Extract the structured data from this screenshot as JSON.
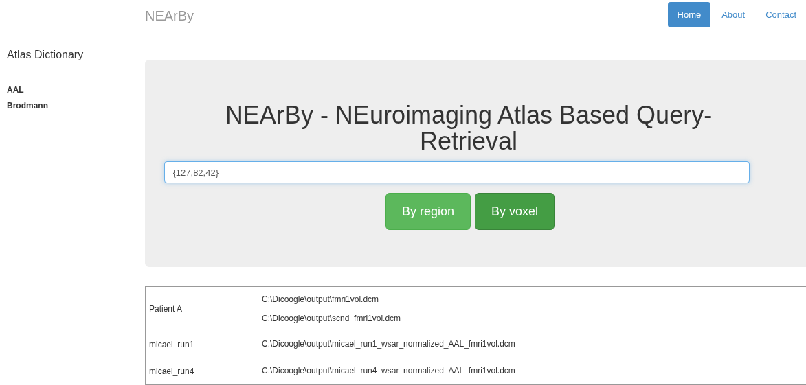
{
  "navbar": {
    "brand": "NEArBy",
    "links": [
      {
        "label": "Home",
        "selected": true
      },
      {
        "label": "About",
        "selected": false
      },
      {
        "label": "Contact",
        "selected": false
      }
    ]
  },
  "sidebar": {
    "title": "Atlas Dictionary",
    "items": [
      "AAL",
      "Brodmann"
    ]
  },
  "hero": {
    "title": "NEArBy - NEuroimaging Atlas Based Query-Retrieval",
    "query": {
      "value": "{127,82,42}"
    },
    "buttons": [
      {
        "label": "By region",
        "active": false
      },
      {
        "label": "By voxel",
        "active": true
      }
    ]
  },
  "table": {
    "rows": [
      {
        "name": "Patient A",
        "files": [
          "C:\\Dicoogle\\output\\fmri1vol.dcm",
          "C:\\Dicoogle\\output\\scnd_fmri1vol.dcm"
        ]
      },
      {
        "name": "micael_run1",
        "files": [
          "C:\\Dicoogle\\output\\micael_run1_wsar_normalized_AAL_fmri1vol.dcm"
        ]
      },
      {
        "name": "micael_run4",
        "files": [
          "C:\\Dicoogle\\output\\micael_run4_wsar_normalized_AAL_fmri1vol.dcm"
        ]
      }
    ]
  }
}
